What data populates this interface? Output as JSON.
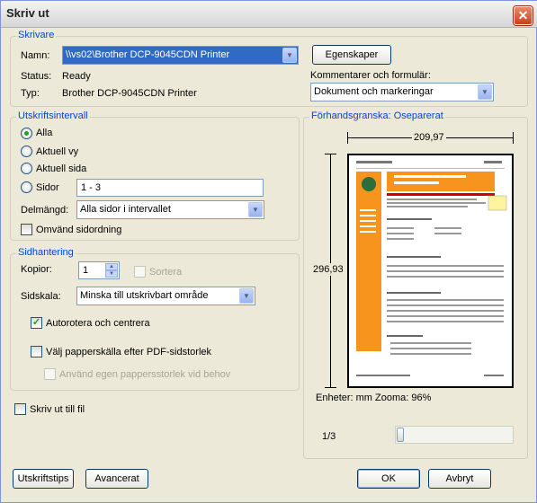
{
  "window": {
    "title": "Skriv ut",
    "close_glyph": "✕"
  },
  "printer": {
    "legend": "Skrivare",
    "name_label": "Namn:",
    "name_value": "\\\\vs02\\Brother DCP-9045CDN Printer",
    "properties_button": "Egenskaper",
    "status_label": "Status:",
    "status_value": "Ready",
    "type_label": "Typ:",
    "type_value": "Brother DCP-9045CDN Printer",
    "comments_label": "Kommentarer och formulär:",
    "comments_value": "Dokument och markeringar"
  },
  "range": {
    "legend": "Utskriftsintervall",
    "all": "Alla",
    "current_view": "Aktuell vy",
    "current_page": "Aktuell sida",
    "pages": "Sidor",
    "pages_value": "1 - 3",
    "subset_label": "Delmängd:",
    "subset_value": "Alla sidor i intervallet",
    "reverse": "Omvänd sidordning",
    "selected": "all"
  },
  "handling": {
    "legend": "Sidhantering",
    "copies_label": "Kopior:",
    "copies_value": "1",
    "collate": "Sortera",
    "scale_label": "Sidskala:",
    "scale_value": "Minska till utskrivbart område",
    "autorotate": "Autorotera och centrera",
    "autorotate_checked": true,
    "paper_source": "Välj papperskälla efter PDF-sidstorlek",
    "paper_source_checked": false,
    "custom_size": "Använd egen pappersstorlek vid behov"
  },
  "print_to_file": "Skriv ut till fil",
  "preview": {
    "legend": "Förhandsgranska: Oseparerat",
    "width": "209,97",
    "height": "296,93",
    "units_zoom": "Enheter: mm Zooma:  96%",
    "page_indicator": "1/3"
  },
  "buttons": {
    "tips": "Utskriftstips",
    "advanced": "Avancerat",
    "ok": "OK",
    "cancel": "Avbryt"
  },
  "colors": {
    "accent": "#0046d5",
    "page_orange": "#f7941d"
  }
}
